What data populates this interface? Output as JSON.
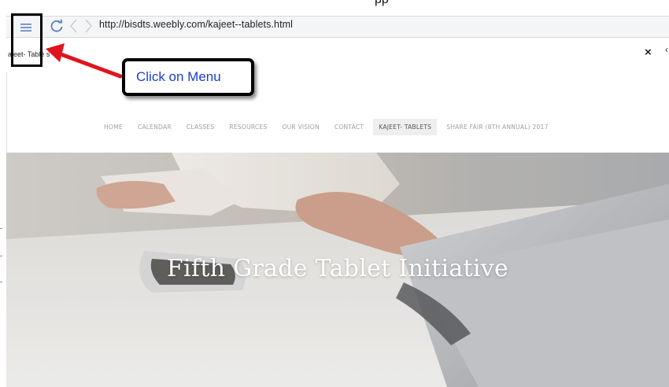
{
  "top_fragment": "pp",
  "browser": {
    "url": "http://bisdts.weebly.com/kajeet--tablets.html",
    "icons": [
      "menu-icon",
      "refresh-icon",
      "back-icon",
      "forward-icon",
      "close-icon"
    ]
  },
  "tab": {
    "title": "ajeet- Table s",
    "close_glyph": "×",
    "edge_glyph": "‹"
  },
  "nav": {
    "items": [
      {
        "label": "HOME",
        "active": false
      },
      {
        "label": "CALENDAR",
        "active": false
      },
      {
        "label": "CLASSES",
        "active": false
      },
      {
        "label": "RESOURCES",
        "active": false
      },
      {
        "label": "OUR VISION",
        "active": false
      },
      {
        "label": "CONTACT",
        "active": false
      },
      {
        "label": "KAJEET- TABLETS",
        "active": true
      },
      {
        "label": "SHARE FAIR (8TH ANNUAL) 2017",
        "active": false
      }
    ]
  },
  "hero": {
    "title": "Fifth Grade Tablet Initiative"
  },
  "annotation": {
    "callout_text": "Click on Menu",
    "arrow_color": "#e0141c",
    "callout_text_color": "#1a3fcf"
  }
}
